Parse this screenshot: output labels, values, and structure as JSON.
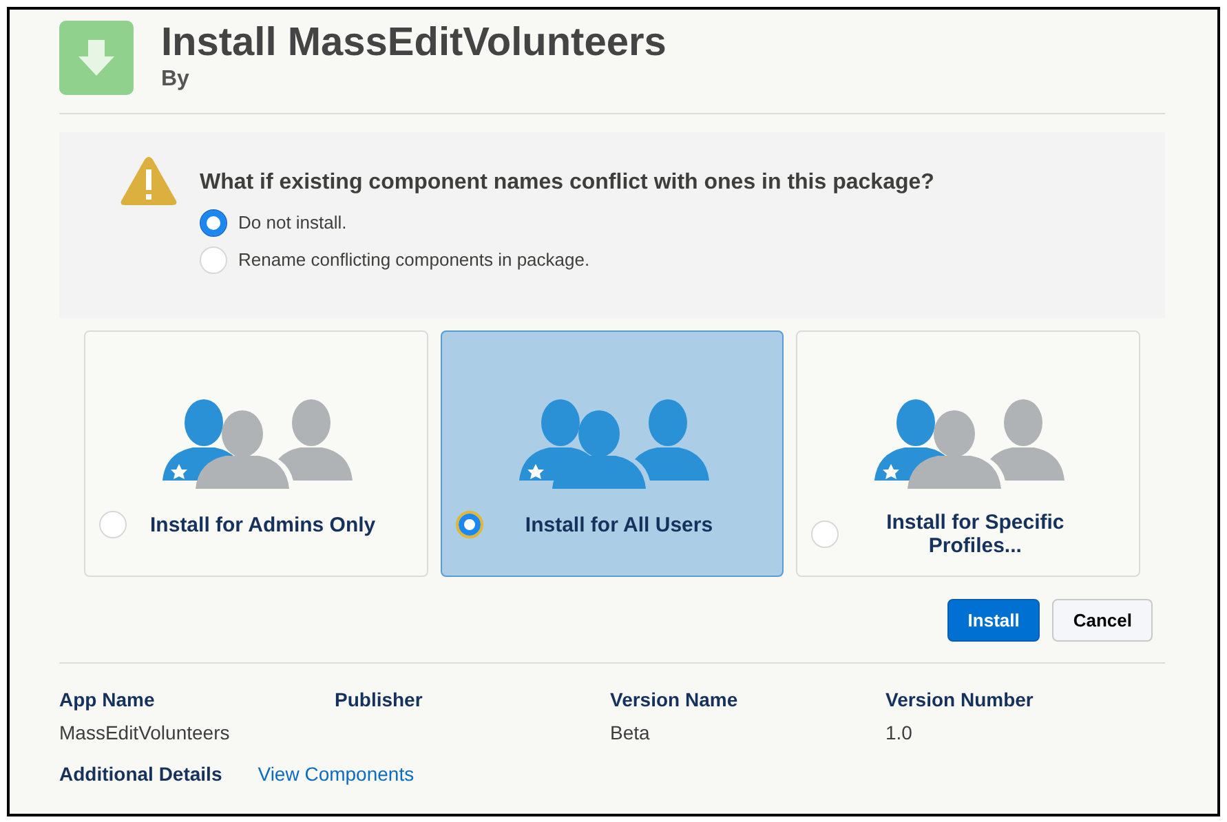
{
  "header": {
    "title": "Install MassEditVolunteers",
    "subtitle": "By"
  },
  "conflict": {
    "question": "What if existing component names conflict with ones in this package?",
    "options": [
      {
        "label": "Do not install.",
        "selected": true
      },
      {
        "label": "Rename conflicting components in package.",
        "selected": false
      }
    ]
  },
  "audiences": [
    {
      "kind": "admins",
      "label": "Install for Admins Only",
      "selected": false
    },
    {
      "kind": "all",
      "label": "Install for All Users",
      "selected": true
    },
    {
      "kind": "profiles",
      "label": "Install for Specific Profiles...",
      "selected": false
    }
  ],
  "buttons": [
    {
      "kind": "primary",
      "label": "Install"
    },
    {
      "kind": "neutral",
      "label": "Cancel"
    }
  ],
  "details": {
    "columns": [
      {
        "label": "App Name",
        "value": "MassEditVolunteers"
      },
      {
        "label": "Publisher"
      },
      {
        "label": "Version Name",
        "value": "Beta"
      },
      {
        "label": "Version Number",
        "value": "1.0"
      }
    ],
    "additional_label": "Additional Details",
    "link": "View Components"
  }
}
